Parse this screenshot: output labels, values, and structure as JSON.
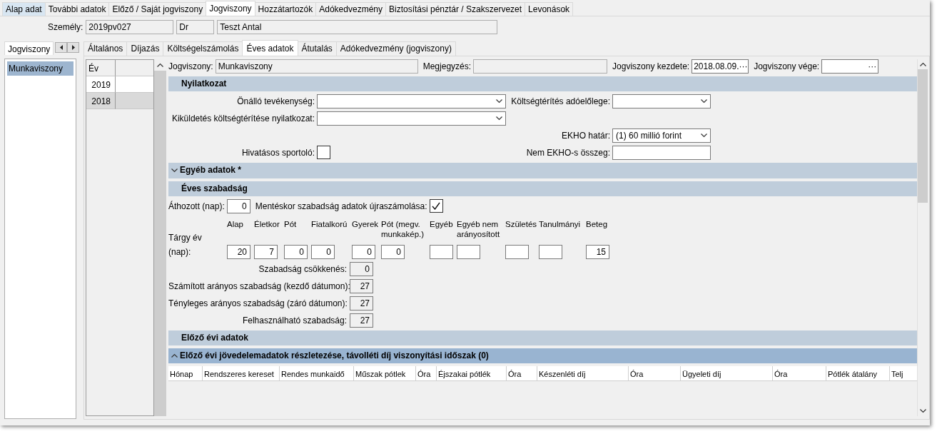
{
  "top_tabs": [
    {
      "label": "Alap adat",
      "selected": false,
      "hovered": true
    },
    {
      "label": "További adatok",
      "selected": false,
      "hovered": false
    },
    {
      "label": "Előző / Saját jogviszony",
      "selected": false,
      "hovered": false
    },
    {
      "label": "Jogviszony",
      "selected": true,
      "hovered": false
    },
    {
      "label": "Hozzátartozók",
      "selected": false,
      "hovered": false
    },
    {
      "label": "Adókedvezmény",
      "selected": false,
      "hovered": false
    },
    {
      "label": "Biztosítási pénztár / Szakszervezet",
      "selected": false,
      "hovered": false
    },
    {
      "label": "Levonások",
      "selected": false,
      "hovered": false
    }
  ],
  "person": {
    "label": "Személy:",
    "code": "2019pv027",
    "title": "Dr",
    "name": "Teszt Antal"
  },
  "left_panel": {
    "tab": "Jogviszony",
    "items": [
      {
        "label": "Munkaviszony",
        "selected": true
      }
    ]
  },
  "inner_tabs": [
    {
      "label": "Általános",
      "selected": false
    },
    {
      "label": "Díjazás",
      "selected": false
    },
    {
      "label": "Költségelszámolás",
      "selected": false
    },
    {
      "label": "Éves adatok",
      "selected": true
    },
    {
      "label": "Átutalás",
      "selected": false
    },
    {
      "label": "Adókedvezmény (jogviszony)",
      "selected": false
    }
  ],
  "year_grid": {
    "column": "Év",
    "rows": [
      {
        "year": "2019",
        "selected": false
      },
      {
        "year": "2018",
        "selected": true
      }
    ]
  },
  "header_fields": [
    {
      "kind": "text",
      "label": "Jogviszony:",
      "value": "Munkaviszony"
    },
    {
      "kind": "text",
      "label": "Megjegyzés:"
    },
    {
      "kind": "date",
      "label": "Jogviszony kezdete:",
      "value": "2018.08.09.",
      "button": "···"
    },
    {
      "kind": "date",
      "label": "Jogviszony vége:",
      "button": "···"
    }
  ],
  "nyilatkozat": {
    "title": "Nyilatkozat",
    "rows": [
      {
        "left": {
          "kind": "select",
          "label": "Önálló tevékenység:"
        },
        "right": {
          "kind": "select",
          "label": "Költségtérítés adóelőlege:"
        }
      },
      {
        "left": {
          "kind": "select",
          "label": "Kiküldetés költségtérítése nyilatkozat:"
        }
      },
      {
        "right": {
          "kind": "select",
          "label": "EKHO határ:",
          "value": "(1) 60 millió forint"
        }
      },
      {
        "left": {
          "kind": "checkbox",
          "label": "Hivatásos sportoló:",
          "checked": false
        },
        "right": {
          "kind": "text",
          "label": "Nem EKHO-s összeg:"
        }
      }
    ]
  },
  "egyeb_adatok": {
    "title": "Egyéb adatok *",
    "expanded": false
  },
  "eves_szabadsag": {
    "title": "Éves szabadság",
    "carried": {
      "label": "Áthozott (nap):",
      "value": "0"
    },
    "recalc": {
      "label": "Mentéskor szabadság adatok újraszámolása:",
      "checked": true
    },
    "row_label": "Tárgy év (nap):",
    "columns": [
      {
        "label": "Alap",
        "value": "20"
      },
      {
        "label": "Életkor",
        "value": "7"
      },
      {
        "label": "Pót",
        "value": "0"
      },
      {
        "label": "Fiatalkorú",
        "value": "0"
      },
      {
        "label": "Gyerek",
        "value": "0"
      },
      {
        "label": "Pót (megv. munkakép.)",
        "value": "0"
      },
      {
        "label": "Egyéb"
      },
      {
        "label": "Egyéb nem arányosított"
      },
      {
        "label": "Születés"
      },
      {
        "label": "Tanulmányi"
      },
      {
        "label": "Beteg",
        "value": "15"
      }
    ],
    "summary": [
      {
        "label": "Szabadság csökkenés:",
        "value": "0"
      },
      {
        "label": "Számított arányos szabadság (kezdő dátumon):",
        "value": "27"
      },
      {
        "label": "Tényleges arányos szabadság (záró dátumon):",
        "value": "27"
      },
      {
        "label": "Felhasználható szabadság:",
        "value": "27"
      }
    ]
  },
  "elozo_evi": {
    "title": "Előző évi adatok"
  },
  "jovedelem": {
    "title": "Előző évi jövedelemadatok részletezése, távolléti díj viszonyítási időszak (0)",
    "expanded": true,
    "columns": [
      "Hónap",
      "Rendszeres kereset",
      "Rendes munkaidő",
      "Műszak pótlek",
      "Óra",
      "Éjszakai pótlék",
      "Óra",
      "Készenléti díj",
      "Óra",
      "Ügyeleti díj",
      "Óra",
      "Pótlék átalány",
      "Telj"
    ]
  }
}
